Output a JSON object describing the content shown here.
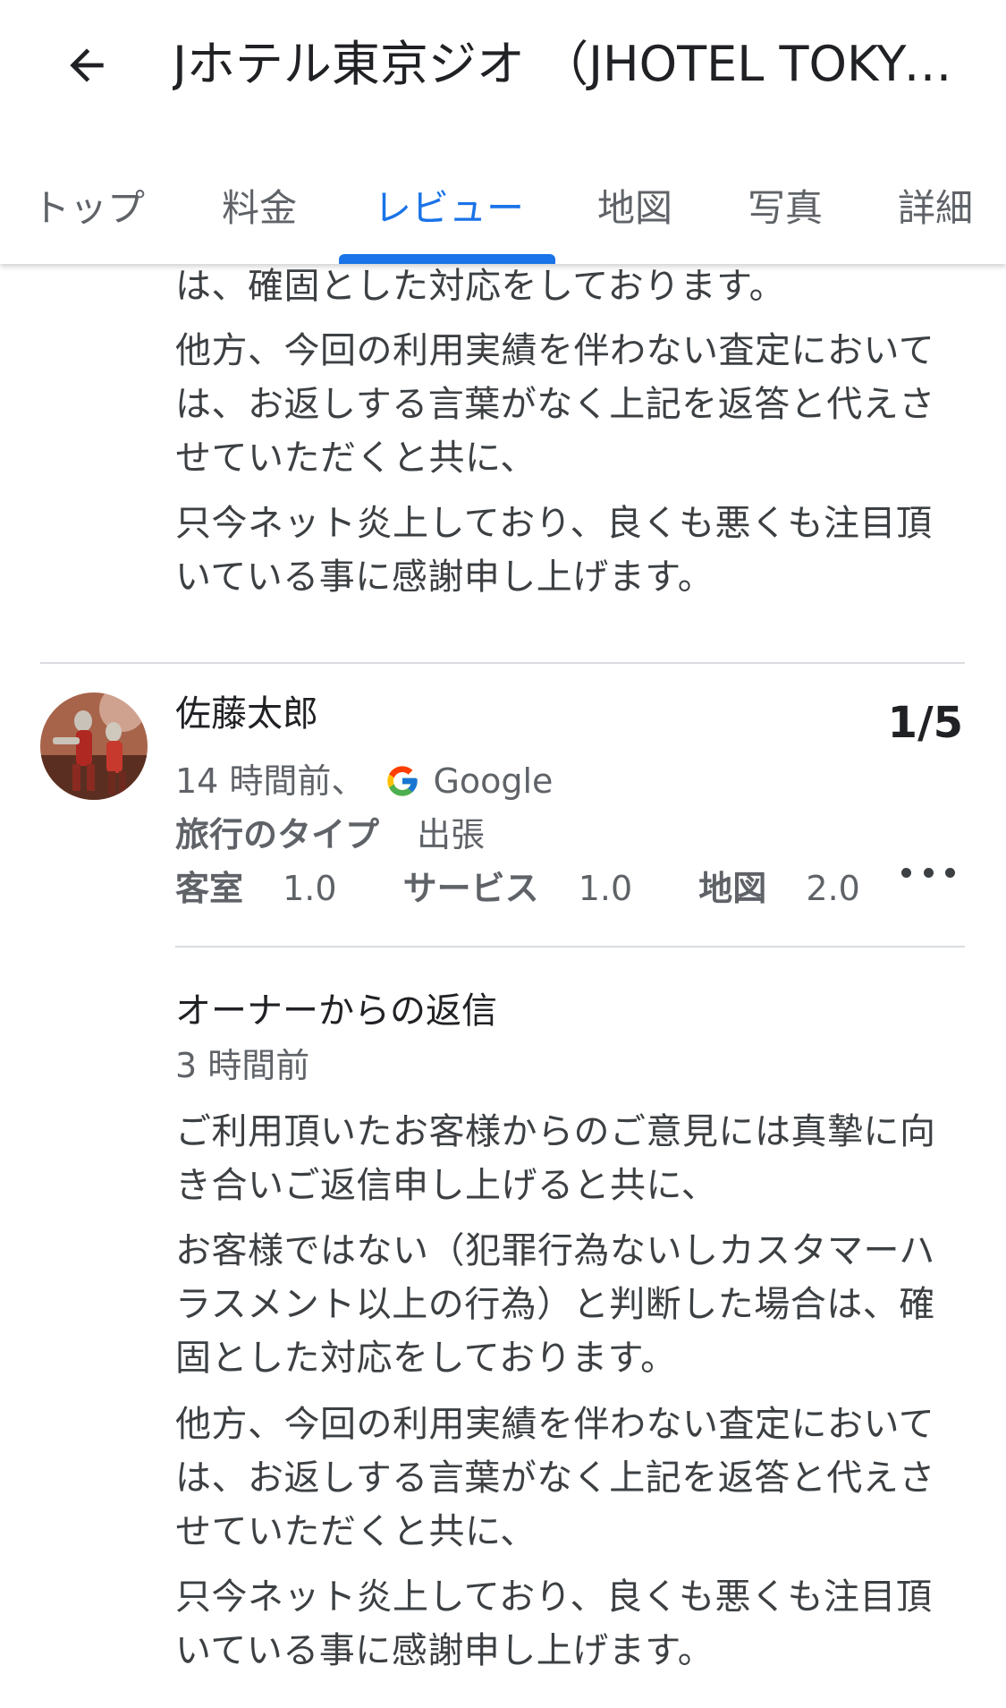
{
  "header": {
    "title": "Jホテル東京ジオ （JHOTEL TOKYO GEO）",
    "back_icon": "arrow-back-icon"
  },
  "tabs": [
    {
      "label": "トップ"
    },
    {
      "label": "料金"
    },
    {
      "label": "レビュー",
      "active": true
    },
    {
      "label": "地図"
    },
    {
      "label": "写真"
    },
    {
      "label": "詳細"
    }
  ],
  "prev_reply": {
    "p1": "は、確固とした対応をしております。",
    "p2": "他方、今回の利用実績を伴わない査定においては、お返しする言葉がなく上記を返答と代えさせていただくと共に、",
    "p3": "只今ネット炎上しており、良くも悪くも注目頂いている事に感謝申し上げます。"
  },
  "review": {
    "reviewer": "佐藤太郎",
    "rating": "1/5",
    "time": "14 時間前、",
    "source": "Google",
    "trip_type_label": "旅行のタイプ",
    "trip_type_value": "出張",
    "scores": [
      {
        "label": "客室",
        "value": "1.0"
      },
      {
        "label": "サービス",
        "value": "1.0"
      },
      {
        "label": "地図",
        "value": "2.0"
      }
    ]
  },
  "owner_reply": {
    "title": "オーナーからの返信",
    "time": "3 時間前",
    "p1": "ご利用頂いたお客様からのご意見には真摯に向き合いご返信申し上げると共に、",
    "p2": "お客様ではない（犯罪行為ないしカスタマーハラスメント以上の行為）と判断した場合は、確固とした対応をしております。",
    "p3": "他方、今回の利用実績を伴わない査定においては、お返しする言葉がなく上記を返答と代えさせていただくと共に、",
    "p4": "只今ネット炎上しており、良くも悪くも注目頂いている事に感謝申し上げます。"
  },
  "colors": {
    "accent": "#1a73e8",
    "text": "#202124",
    "secondary": "#5f6368",
    "divider": "#dadce0"
  }
}
